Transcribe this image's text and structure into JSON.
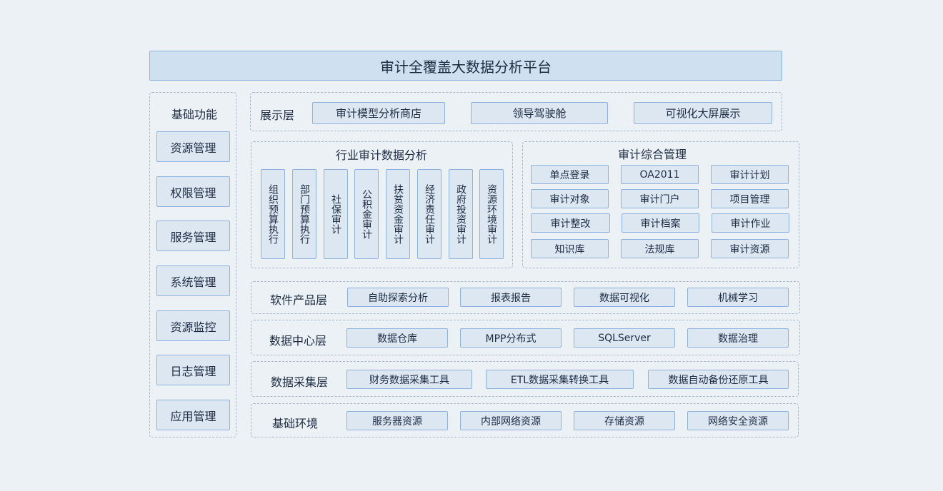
{
  "title": "审计全覆盖大数据分析平台",
  "basic": {
    "header": "基础功能",
    "items": [
      "资源管理",
      "权限管理",
      "服务管理",
      "系统管理",
      "资源监控",
      "日志管理",
      "应用管理"
    ]
  },
  "display_layer": {
    "label": "展示层",
    "items": [
      "审计模型分析商店",
      "领导驾驶舱",
      "可视化大屏展示"
    ]
  },
  "industry": {
    "header": "行业审计数据分析",
    "items": [
      "组织预算执行",
      "部门预算执行",
      "社保审计",
      "公积金审计",
      "扶贫资金审计",
      "经济责任审计",
      "政府投资审计",
      "资源环境审计"
    ]
  },
  "management": {
    "header": "审计综合管理",
    "items": [
      "单点登录",
      "OA2011",
      "审计计划",
      "审计对象",
      "审计门户",
      "项目管理",
      "审计整改",
      "审计档案",
      "审计作业",
      "知识库",
      "法规库",
      "审计资源"
    ]
  },
  "software_layer": {
    "label": "软件产品层",
    "items": [
      "自助探索分析",
      "报表报告",
      "数据可视化",
      "机械学习"
    ]
  },
  "datacenter_layer": {
    "label": "数据中心层",
    "items": [
      "数据仓库",
      "MPP分布式",
      "SQLServer",
      "数据治理"
    ]
  },
  "collection_layer": {
    "label": "数据采集层",
    "items": [
      "财务数据采集工具",
      "ETL数据采集转换工具",
      "数据自动备份还原工具"
    ]
  },
  "infra_layer": {
    "label": "基础环境",
    "items": [
      "服务器资源",
      "内部网络资源",
      "存储资源",
      "网络安全资源"
    ]
  }
}
